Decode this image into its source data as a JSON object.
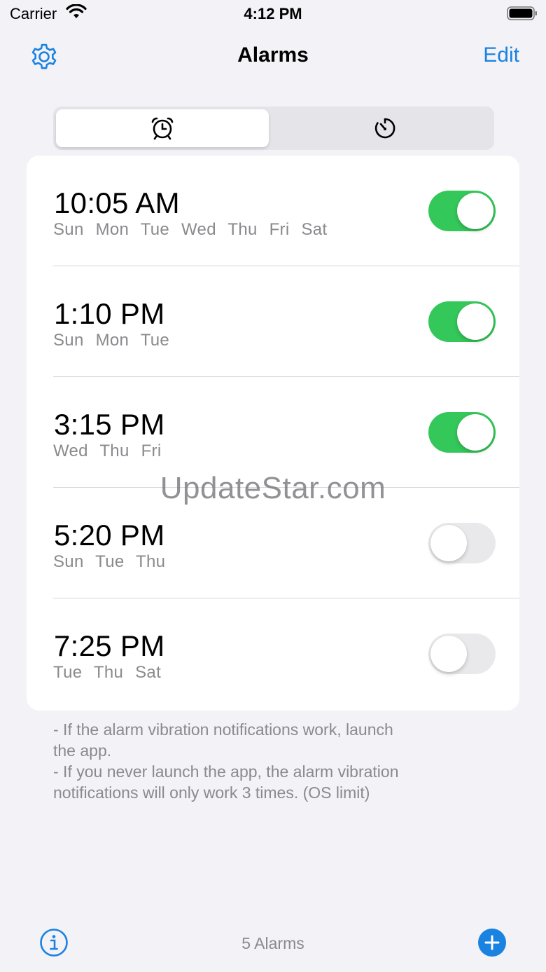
{
  "status_bar": {
    "carrier": "Carrier",
    "time": "4:12 PM"
  },
  "nav": {
    "title": "Alarms",
    "edit_label": "Edit"
  },
  "segments": [
    {
      "icon": "alarm-clock-icon",
      "selected": true
    },
    {
      "icon": "timer-icon",
      "selected": false
    }
  ],
  "alarms": [
    {
      "time": "10:05 AM",
      "days": "Sun Mon Tue Wed Thu Fri Sat",
      "enabled": true
    },
    {
      "time": "1:10 PM",
      "days": "Sun Mon Tue",
      "enabled": true
    },
    {
      "time": "3:15 PM",
      "days": "Wed Thu Fri",
      "enabled": true
    },
    {
      "time": "5:20 PM",
      "days": "Sun Tue Thu",
      "enabled": false
    },
    {
      "time": "7:25 PM",
      "days": "Tue Thu Sat",
      "enabled": false
    }
  ],
  "watermark": "UpdateStar.com",
  "notes": [
    "- If the alarm vibration notifications work, launch",
    "the app.",
    "- If you never launch the app, the alarm vibration",
    "notifications will only work 3 times. (OS limit)"
  ],
  "toolbar": {
    "count_label": "5 Alarms"
  },
  "colors": {
    "accent": "#1a82e0",
    "toggle_on": "#34c759",
    "toggle_off": "#e9e9eb",
    "background": "#f2f2f7"
  }
}
